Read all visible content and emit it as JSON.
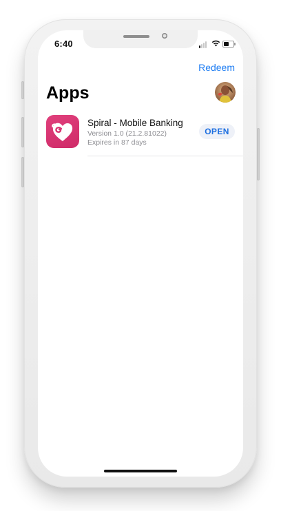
{
  "status_bar": {
    "time": "6:40",
    "signal_bars_active": 1,
    "signal_bars_total": 4,
    "battery_level": 0.55
  },
  "nav": {
    "redeem_label": "Redeem"
  },
  "page": {
    "title": "Apps"
  },
  "apps": [
    {
      "name": "Spiral - Mobile Banking",
      "version": "Version 1.0 (21.2.81022)",
      "expiry": "Expires in 87 days",
      "action_label": "OPEN",
      "icon": "spiral-heart-icon",
      "icon_color": "#d93572"
    }
  ],
  "colors": {
    "accent": "#1d7cf2",
    "open_button_bg": "#eef1f8",
    "secondary_text": "#8e8e93"
  },
  "icons": {
    "avatar": "user-avatar",
    "wifi": "wifi-icon",
    "battery": "battery-icon",
    "signal": "cellular-signal-icon"
  }
}
